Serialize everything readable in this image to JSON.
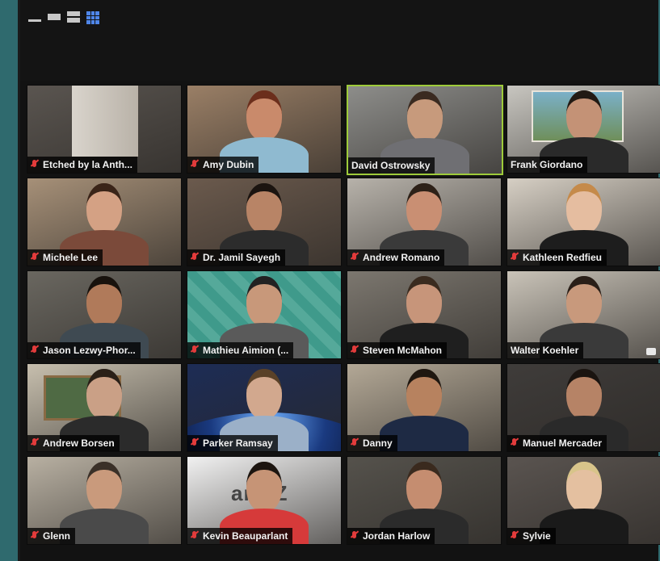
{
  "window": {
    "layout_mode": "gallery-view"
  },
  "participants": [
    {
      "name": "Etched by la Anth...",
      "muted": true,
      "bg": "#5a5550",
      "head": "none",
      "active": false
    },
    {
      "name": "Amy Dubin",
      "muted": true,
      "bg": "#9a7f66",
      "head": "#c98a6b",
      "hair": "#6b2e1c",
      "shirt": "#8fbad0",
      "active": false
    },
    {
      "name": "David Ostrowsky",
      "muted": false,
      "bg": "#8d8d8a",
      "head": "#c79a7c",
      "hair": "#3a2a20",
      "shirt": "#6f6f73",
      "active": true
    },
    {
      "name": "Frank Giordano",
      "muted": false,
      "bg": "#c8c6c0",
      "head": "#c49276",
      "hair": "#221a14",
      "shirt": "#2a2a2a",
      "active": false
    },
    {
      "name": "Michele Lee",
      "muted": true,
      "bg": "#a69078",
      "head": "#d4a184",
      "hair": "#3a2418",
      "shirt": "#7b4a3a",
      "active": false
    },
    {
      "name": "Dr. Jamil Sayegh",
      "muted": true,
      "bg": "#6b5a4d",
      "head": "#b88466",
      "hair": "#1b1410",
      "shirt": "#2c2c2c",
      "active": false
    },
    {
      "name": "Andrew Romano",
      "muted": true,
      "bg": "#b7b2aa",
      "head": "#c98f73",
      "hair": "#2d2118",
      "shirt": "#3a3a3a",
      "active": false
    },
    {
      "name": "Kathleen Redfieu",
      "muted": true,
      "bg": "#d6cfc4",
      "head": "#e5bda0",
      "hair": "#c58a4a",
      "shirt": "#1d1d1d",
      "active": false
    },
    {
      "name": "Jason Lezwy-Phor...",
      "muted": true,
      "bg": "#6a6760",
      "head": "#b07a5a",
      "hair": "#18120d",
      "shirt": "#3f4a52",
      "active": false
    },
    {
      "name": "Mathieu Aimion (...",
      "muted": true,
      "bg": "#4f9c8e",
      "head": "#c8987a",
      "hair": "#222222",
      "shirt": "#5a5a5a",
      "active": false
    },
    {
      "name": "Steven McMahon",
      "muted": true,
      "bg": "#7c776f",
      "head": "#c7957a",
      "hair": "#3a2b1f",
      "shirt": "#1f1f1f",
      "active": false
    },
    {
      "name": "Walter Koehler",
      "muted": false,
      "bg": "#c9c3b8",
      "head": "#c8997c",
      "hair": "#2a1f18",
      "shirt": "#3a3a3a",
      "active": false
    },
    {
      "name": "Andrew Borsen",
      "muted": true,
      "bg": "#c7bfae",
      "head": "#caa086",
      "hair": "#2a2018",
      "shirt": "#2b2b2b",
      "active": false
    },
    {
      "name": "Parker Ramsay",
      "muted": true,
      "bg": "#1d2c55",
      "head": "#d2a88e",
      "hair": "#5a4128",
      "shirt": "#9bb0c8",
      "active": false
    },
    {
      "name": "Danny",
      "muted": true,
      "bg": "#b3a896",
      "head": "#b7825f",
      "hair": "#1f1710",
      "shirt": "#1e2a44",
      "active": false
    },
    {
      "name": "Manuel Mercader",
      "muted": true,
      "bg": "#3f3c3a",
      "head": "#b68366",
      "hair": "#1a1410",
      "shirt": "#2a2a2a",
      "active": false
    },
    {
      "name": "Glenn",
      "muted": true,
      "bg": "#b8b0a2",
      "head": "#c99a7c",
      "hair": "#3a3028",
      "shirt": "#4a4a4a",
      "active": false
    },
    {
      "name": "Kevin Beauparlant",
      "muted": true,
      "bg": "#f1f1f1",
      "head": "#c69476",
      "hair": "#1c1510",
      "shirt": "#d63a3a",
      "active": false
    },
    {
      "name": "Jordan Harlow",
      "muted": true,
      "bg": "#55524c",
      "head": "#c58d70",
      "hair": "#3a2a1e",
      "shirt": "#2b2b2b",
      "active": false
    },
    {
      "name": "Sylvie",
      "muted": true,
      "bg": "#5a5450",
      "head": "#e4c0a0",
      "hair": "#d8c48a",
      "shirt": "#1a1a1a",
      "active": false
    }
  ],
  "background_text": {
    "kevin_logo": "anOZ"
  }
}
